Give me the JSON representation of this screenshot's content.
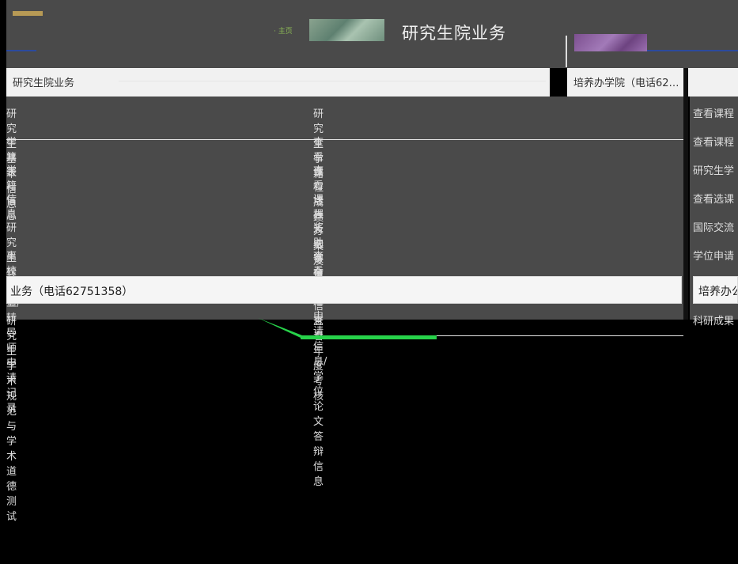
{
  "header": {
    "small_label": "· 主页",
    "title": "研究生院业务"
  },
  "left_pane": {
    "title": "研究生院业务"
  },
  "right_pane": {
    "title": "培养办学院（电话62…"
  },
  "main_rows": [
    {
      "c1": "研究生基本信息",
      "c2": "研究生学籍"
    },
    {
      "c1": "学籍表",
      "c2": "查看课程成绩"
    },
    {
      "c1": "学籍信息",
      "c2": "查看培养方案及课程信息"
    },
    {
      "c1": "信息",
      "c2": "课程及选课信息"
    },
    {
      "c1": "研究生转专业/转导师申请记录",
      "c2": "奖助学金"
    },
    {
      "c1": "离校申请",
      "c2": "查看学位申请信息/学位论文答辩信息"
    }
  ],
  "selected_row": {
    "label": "业务（电话62751358）"
  },
  "bottom_row": {
    "c1": "研究生学术规范与学术道德测试",
    "c2": "查看年度考核"
  },
  "side_rows": [
    {
      "label": "查看课程"
    },
    {
      "label": "查看课程"
    },
    {
      "label": "研究生学"
    },
    {
      "label": "查看选课"
    },
    {
      "label": "国际交流"
    },
    {
      "label": "学位申请"
    }
  ],
  "side_selected": {
    "label": "培养办公"
  },
  "side_bottom": {
    "label": "科研成果"
  },
  "colors": {
    "panel": "#4a4a4a",
    "selected": "#f5f5f5",
    "accent_blue": "#2b4a9e",
    "cursor_green": "#27d24a"
  }
}
